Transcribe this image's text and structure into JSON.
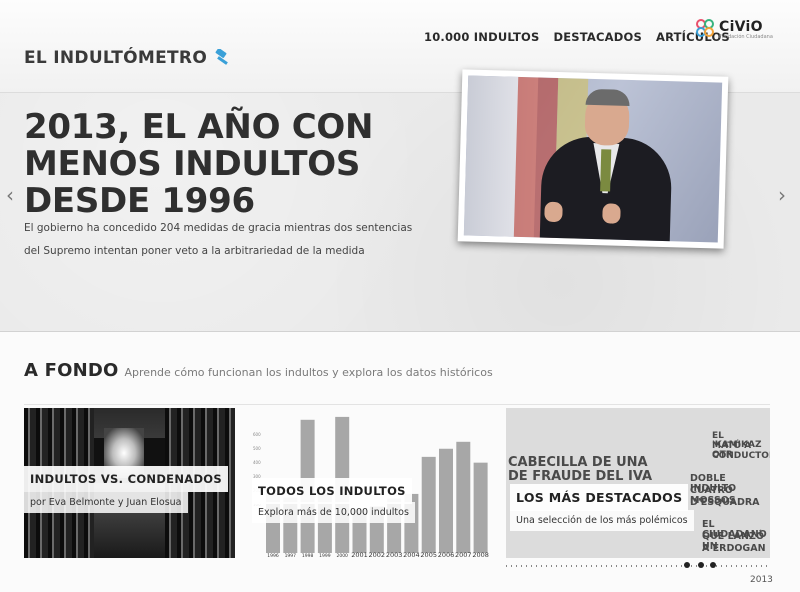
{
  "header": {
    "brand": "EL INDULTÓMETRO",
    "nav": [
      "10.000 INDULTOS",
      "DESTACADOS",
      "ARTÍCULOS"
    ],
    "partner": {
      "name": "CiViO",
      "tagline": "Fundación Ciudadana"
    }
  },
  "hero": {
    "title": "2013, EL AÑO CON MENOS INDULTOS DESDE 1996",
    "subtitle": "El gobierno ha concedido 204 medidas de gracia mientras dos sentencias del Supremo intentan poner veto a la arbitrariedad de la medida",
    "prev_arrow": "‹",
    "next_arrow": "›"
  },
  "section": {
    "title": "A FONDO",
    "subtitle": "Aprende cómo funcionan los indultos y explora los datos históricos"
  },
  "cards": [
    {
      "title": "INDULTOS VS. CONDENADOS",
      "subtitle": "por Eva Belmonte y Juan Elosua"
    },
    {
      "title": "TODOS LOS INDULTOS",
      "subtitle": "Explora más de 10,000 indultos"
    },
    {
      "title": "LOS MÁS DESTACADOS",
      "subtitle": "Una selección de los más polémicos"
    }
  ],
  "chart_data": {
    "type": "bar",
    "categories": [
      "1996",
      "1997",
      "1998",
      "1999",
      "2000",
      "2001",
      "2002",
      "2003",
      "2004",
      "2005",
      "2006",
      "2007",
      "2008"
    ],
    "values": [
      520,
      480,
      1150,
      510,
      1175,
      380,
      400,
      470,
      510,
      830,
      900,
      960,
      780
    ],
    "ylim": [
      0,
      1200
    ],
    "yticks": [
      "600",
      "500",
      "400",
      "300",
      "200",
      "100"
    ]
  },
  "newspaper": {
    "headlines": [
      "CABECILLA DE UNA",
      "DE FRAUDE DEL IVA",
      "EL 'KAMIKAZ",
      "MATÓ A OTR",
      "CONDUCTOR",
      "DOBLE INDULTO",
      "CUATRO MOSSOS",
      "D'ESQUADRA",
      "EL CIUDADANO",
      "QUE LANZÓ UN",
      "A ERDOGAN"
    ]
  },
  "timeline": {
    "year": "2013"
  }
}
